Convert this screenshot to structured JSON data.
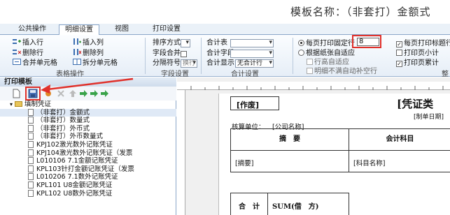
{
  "title": {
    "template_name": "模板名称：（非套打）金额式"
  },
  "tabs": [
    "公共操作",
    "明细设置",
    "视图",
    "打印设置"
  ],
  "active_tab": 1,
  "ribbon": {
    "table_ops": {
      "insert_row": "插入行",
      "insert_col": "插入列",
      "delete_row": "删除行",
      "delete_col": "删除列",
      "merge_cells": "合并单元格",
      "split_cells": "拆分单元格",
      "group_label": "表格操作"
    },
    "field_settings": {
      "sort_mode": "排序方式",
      "field_merge": "字段合并",
      "separator": "分隔符号",
      "separator_value": "换行",
      "group_label": "字段设置"
    },
    "total_settings": {
      "total_table": "合计表",
      "total_field": "合计字段",
      "total_display": "合计显示",
      "total_display_value": "无合计行",
      "group_label": "合计设置"
    },
    "print_settings": {
      "fixed_rows_label": "每页打印固定行",
      "fixed_rows_value": "8",
      "adapt_paper": "根据纸张自适应",
      "row_height_adapt": "行高自适应",
      "detail_fill": "明细不满自动补空行",
      "print_title_each_page": "每页打印标题行",
      "print_page_subtotal": "打印页小计",
      "print_page_cumulative": "打印页累计",
      "group_label_partial": "整"
    }
  },
  "left_panel": {
    "header": "打印模板",
    "tree_root": "填制凭证",
    "items": [
      "（非套打）金额式",
      "（非套打）数量式",
      "（非套打）外币式",
      "（非套打）外币数量式",
      "KPJ102激光数外记账凭证",
      "KPJ104激光数外记账凭证（发票",
      "L010106 7.1金额记账凭证",
      "KPL103针打金额记账凭证（发票",
      "L010206 7.1数外记账凭证",
      "KPL101 U8金额记账凭证",
      "KPL102 U8数外记账凭证"
    ]
  },
  "paper": {
    "void_label": "[作废]",
    "voucher_type": "[凭证类",
    "prepared_date": "[制单日期]",
    "accounting_unit_label": "核算单位：",
    "company_name": "[公司名称]",
    "col_summary": "摘　要",
    "col_account": "会计科目",
    "summary_field": "[摘要]",
    "account_field": "[科目名称]",
    "total_label": "合　计",
    "total_formula": "SUM(借　方)"
  },
  "colors": {
    "accent_red": "#e0302a",
    "ribbon_border": "#8aa6c8"
  }
}
